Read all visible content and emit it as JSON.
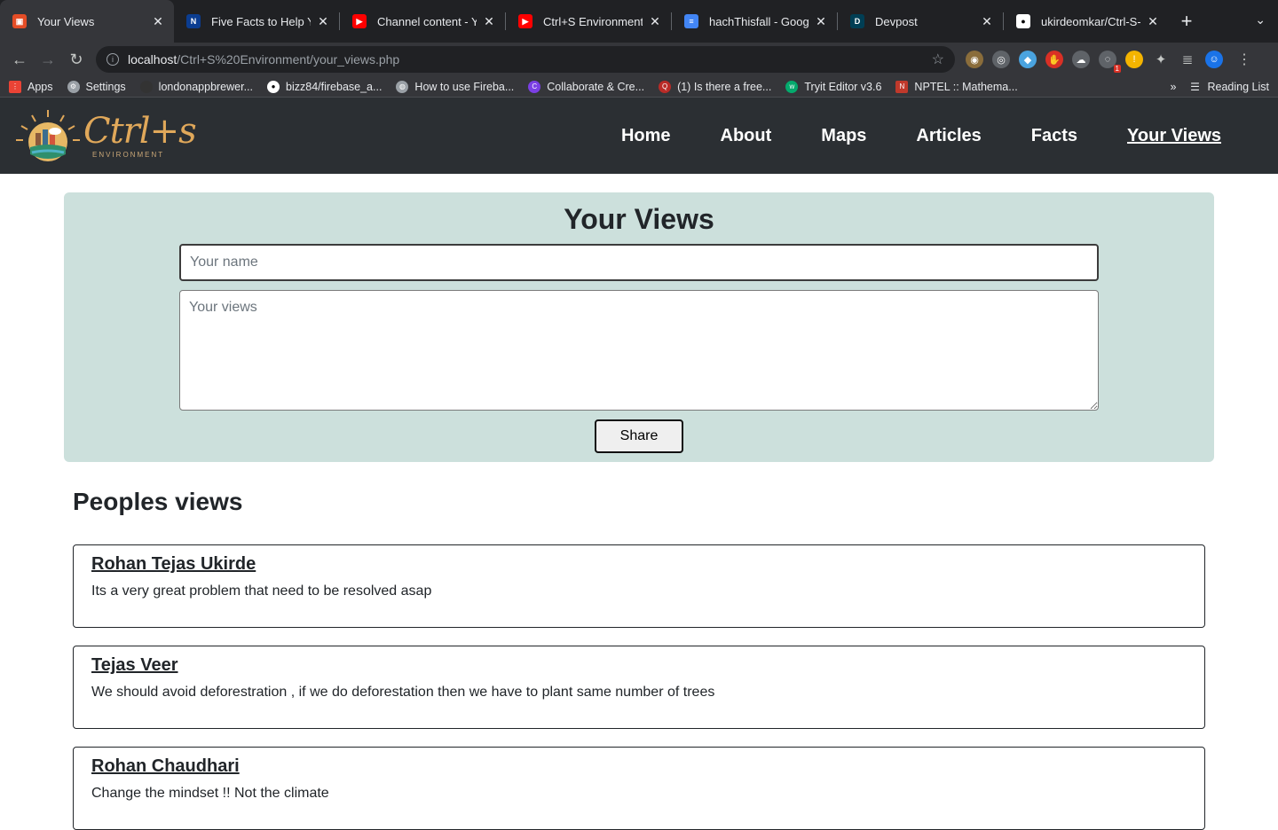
{
  "browser": {
    "tabs": [
      {
        "title": "Your Views",
        "favicon_color": "#e44d26",
        "active": true
      },
      {
        "title": "Five Facts to Help You",
        "favicon_color": "#0b3d91",
        "active": false
      },
      {
        "title": "Channel content - You",
        "favicon_color": "#ff0000",
        "active": false
      },
      {
        "title": "Ctrl+S Environment |",
        "favicon_color": "#ff0000",
        "active": false
      },
      {
        "title": "hachThisfall - Google",
        "favicon_color": "#4285f4",
        "active": false
      },
      {
        "title": "Devpost",
        "favicon_color": "#003e54",
        "active": false
      },
      {
        "title": "ukirdeomkar/Ctrl-S-E",
        "favicon_color": "#ffffff",
        "active": false
      }
    ],
    "url_host": "localhost",
    "url_path": "/Ctrl+S%20Environment/your_views.php",
    "bookmarks": [
      {
        "label": "Apps",
        "icon_color": "#ea4335"
      },
      {
        "label": "Settings",
        "icon_color": "#9aa0a6"
      },
      {
        "label": "londonappbrewer...",
        "icon_color": "#333333"
      },
      {
        "label": "bizz84/firebase_a...",
        "icon_color": "#ffffff"
      },
      {
        "label": "How to use Fireba...",
        "icon_color": "#9aa0a6"
      },
      {
        "label": "Collaborate & Cre...",
        "icon_color": "#7b3fe4"
      },
      {
        "label": "(1) Is there a free...",
        "icon_color": "#b92b27"
      },
      {
        "label": "Tryit Editor v3.6",
        "icon_color": "#04aa6d"
      },
      {
        "label": "NPTEL :: Mathema...",
        "icon_color": "#c0392b"
      }
    ],
    "reading_list": "Reading List",
    "extension_badge": "1"
  },
  "site": {
    "logo_text": "Ctrl+s",
    "logo_sub": "ENVIRONMENT",
    "nav": [
      "Home",
      "About",
      "Maps",
      "Articles",
      "Facts",
      "Your Views"
    ]
  },
  "form": {
    "title": "Your Views",
    "name_placeholder": "Your name",
    "views_placeholder": "Your views",
    "share_label": "Share"
  },
  "people": {
    "heading": "Peoples views",
    "views": [
      {
        "author": "Rohan Tejas Ukirde",
        "text": "Its a very great problem that need to be resolved asap"
      },
      {
        "author": "Tejas Veer",
        "text": "We should avoid deforestration , if we do deforestation then we have to plant same number of trees"
      },
      {
        "author": "Rohan Chaudhari",
        "text": "Change the mindset !! Not the climate"
      }
    ]
  }
}
